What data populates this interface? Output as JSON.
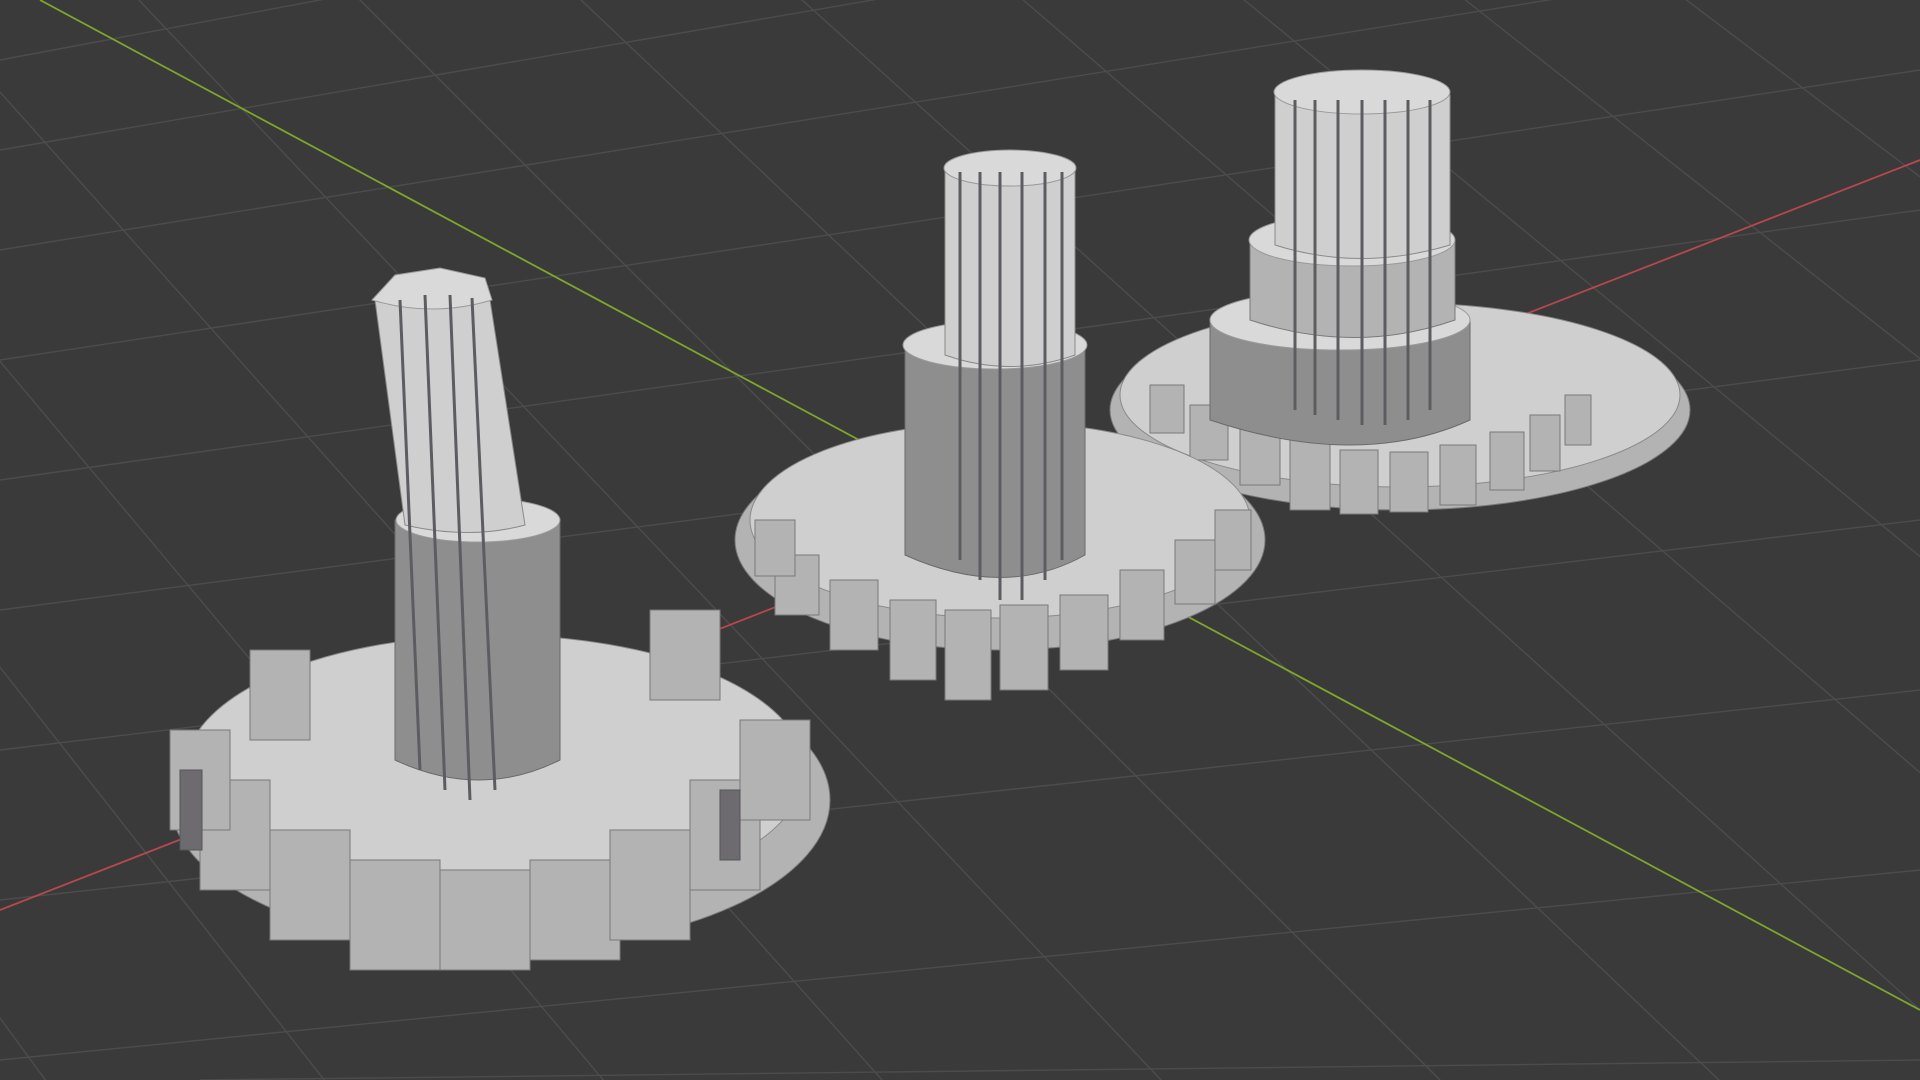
{
  "viewport": {
    "background": "#3a3a3a",
    "grid_color": "#4c4c4c",
    "x_axis_color": "#b9474f",
    "y_axis_color": "#7fa62a",
    "objects": [
      {
        "name": "gear-tower-left"
      },
      {
        "name": "gear-tower-center"
      },
      {
        "name": "gear-tower-right"
      }
    ]
  }
}
